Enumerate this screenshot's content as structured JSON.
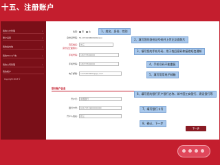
{
  "slide_title": "十五、注册账户",
  "sidebar": {
    "items": [
      {
        "label": "我的公文管理",
        "arrow": "›"
      },
      {
        "label": "账户设置",
        "arrow": "›"
      },
      {
        "label": "我的站内信",
        "arrow": "›"
      },
      {
        "label": "我的Micro广告",
        "arrow": "›"
      },
      {
        "label": "我的公司管理",
        "arrow": "›"
      },
      {
        "label": "我的帐户",
        "arrow": ""
      }
    ],
    "copyright": "Copyright 2013 ©"
  },
  "form": {
    "gender": {
      "label": "性别:",
      "male": "男",
      "female": "女"
    },
    "id_card": {
      "label": "身份证号码:",
      "value": "51172219860909xxxx"
    },
    "real_name": {
      "label": "真实姓名:",
      "value": "张三"
    },
    "id_photo": {
      "label": "身份证正面照片:",
      "value": "上传附件"
    },
    "mobile": {
      "label": "手机号码:",
      "value": "18727300000"
    },
    "email": {
      "label": "电子邮箱:",
      "value": "1375678906@qq.com"
    },
    "bank_section_title": "银行账户信息",
    "bank_name": {
      "label": "开户行:",
      "value": "中国银行"
    },
    "account_number": {
      "label": "银行卡号:",
      "value": "6217071990000000"
    },
    "account_holder": {
      "label": "开户人姓名:",
      "value": "张三"
    },
    "next_button": "下一步"
  },
  "callouts": [
    "1、姓名、身份、性别",
    "2、填写您的身份证号码并上传正反面照片",
    "3、填写您的手机号码，用于找回密码和接收短信通知",
    "4、手机号码不能重复",
    "5、填写常用电子邮箱",
    "6、填写您的银行开户银行名称，如中国工商银行、建设银行等",
    "7、填写银行卡号",
    "8、确认，下一步"
  ],
  "colors": {
    "background": "#c41e2e",
    "sidebar": "#7a0f18",
    "callout": "#a8c8ec",
    "button": "#8a1b24"
  }
}
